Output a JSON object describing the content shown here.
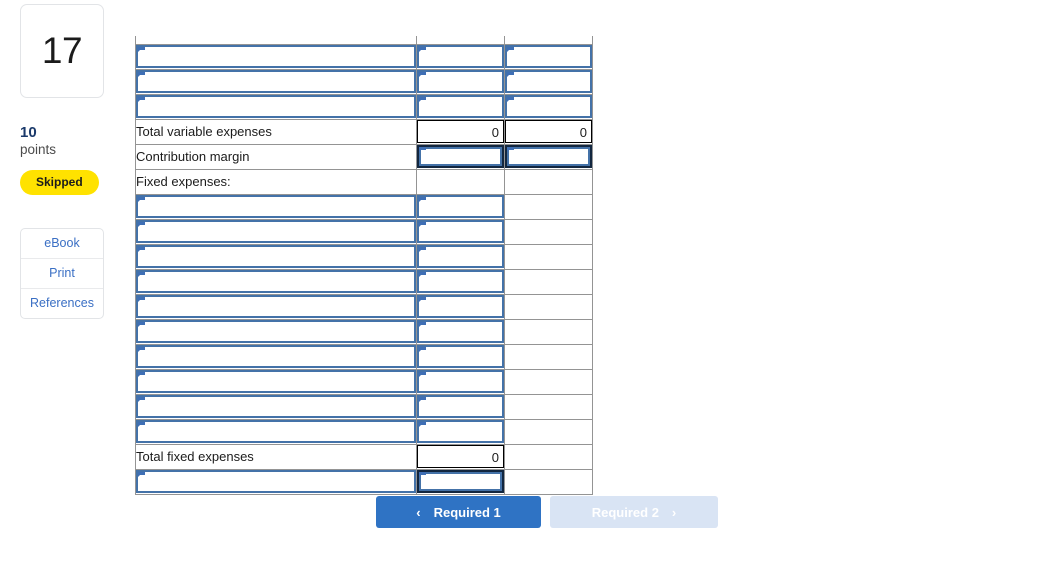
{
  "left_rail": {
    "question_number": "17",
    "points_value": "10",
    "points_label": "points",
    "status_badge": "Skipped",
    "tools": [
      {
        "label": "eBook"
      },
      {
        "label": "Print"
      },
      {
        "label": "References"
      }
    ]
  },
  "worksheet": {
    "columns": [
      "",
      "",
      ""
    ],
    "rows": [
      {
        "type": "clip",
        "label": "",
        "col1": "",
        "col2": "",
        "col1_kind": "input-clip",
        "col2_kind": "input-clip",
        "label_kind": "input-clip"
      },
      {
        "type": "input",
        "label": "",
        "col1": "",
        "col2": "",
        "col1_kind": "input",
        "col2_kind": "input",
        "label_kind": "input"
      },
      {
        "type": "input",
        "label": "",
        "col1": "",
        "col2": "",
        "col1_kind": "input",
        "col2_kind": "input",
        "label_kind": "input"
      },
      {
        "type": "input",
        "label": "",
        "col1": "",
        "col2": "",
        "col1_kind": "input",
        "col2_kind": "input",
        "label_kind": "input"
      },
      {
        "type": "total",
        "label": "Total variable expenses",
        "col1": "0",
        "col2": "0",
        "col1_kind": "calc",
        "col2_kind": "calc",
        "label_kind": "text"
      },
      {
        "type": "input",
        "label": "Contribution margin",
        "col1": "",
        "col2": "",
        "col1_kind": "input-dark",
        "col2_kind": "input-dark",
        "label_kind": "text"
      },
      {
        "type": "header",
        "label": "Fixed expenses:",
        "col1": "",
        "col2": "",
        "col1_kind": "blank",
        "col2_kind": "blank",
        "label_kind": "text"
      },
      {
        "type": "input",
        "label": "",
        "col1": "",
        "col2": "",
        "col1_kind": "input",
        "col2_kind": "blank",
        "label_kind": "input"
      },
      {
        "type": "input",
        "label": "",
        "col1": "",
        "col2": "",
        "col1_kind": "input",
        "col2_kind": "blank",
        "label_kind": "input"
      },
      {
        "type": "input",
        "label": "",
        "col1": "",
        "col2": "",
        "col1_kind": "input",
        "col2_kind": "blank",
        "label_kind": "input"
      },
      {
        "type": "input",
        "label": "",
        "col1": "",
        "col2": "",
        "col1_kind": "input",
        "col2_kind": "blank",
        "label_kind": "input"
      },
      {
        "type": "input",
        "label": "",
        "col1": "",
        "col2": "",
        "col1_kind": "input",
        "col2_kind": "blank",
        "label_kind": "input"
      },
      {
        "type": "input",
        "label": "",
        "col1": "",
        "col2": "",
        "col1_kind": "input",
        "col2_kind": "blank",
        "label_kind": "input"
      },
      {
        "type": "input",
        "label": "",
        "col1": "",
        "col2": "",
        "col1_kind": "input",
        "col2_kind": "blank",
        "label_kind": "input"
      },
      {
        "type": "input",
        "label": "",
        "col1": "",
        "col2": "",
        "col1_kind": "input",
        "col2_kind": "blank",
        "label_kind": "input"
      },
      {
        "type": "input",
        "label": "",
        "col1": "",
        "col2": "",
        "col1_kind": "input",
        "col2_kind": "blank",
        "label_kind": "input"
      },
      {
        "type": "input",
        "label": "",
        "col1": "",
        "col2": "",
        "col1_kind": "input",
        "col2_kind": "blank",
        "label_kind": "input"
      },
      {
        "type": "total",
        "label": "Total fixed expenses",
        "col1": "0",
        "col2": "",
        "col1_kind": "calc",
        "col2_kind": "blank",
        "label_kind": "text"
      },
      {
        "type": "input",
        "label": "",
        "col1": "",
        "col2": "",
        "col1_kind": "input-dark",
        "col2_kind": "blank",
        "label_kind": "input"
      }
    ]
  },
  "nav": {
    "prev_label": "Required 1",
    "prev_chevron": "‹",
    "next_label": "Required 2",
    "next_chevron": "›"
  },
  "colors": {
    "input_border": "#4472a8",
    "focus_border": "#12263f",
    "grid_border": "#949494",
    "badge_yellow": "#ffe200",
    "primary_button": "#2f73c4",
    "disabled_button": "#d9e4f4",
    "link_blue": "#3a6fc4",
    "points_blue": "#1b3a6b"
  }
}
